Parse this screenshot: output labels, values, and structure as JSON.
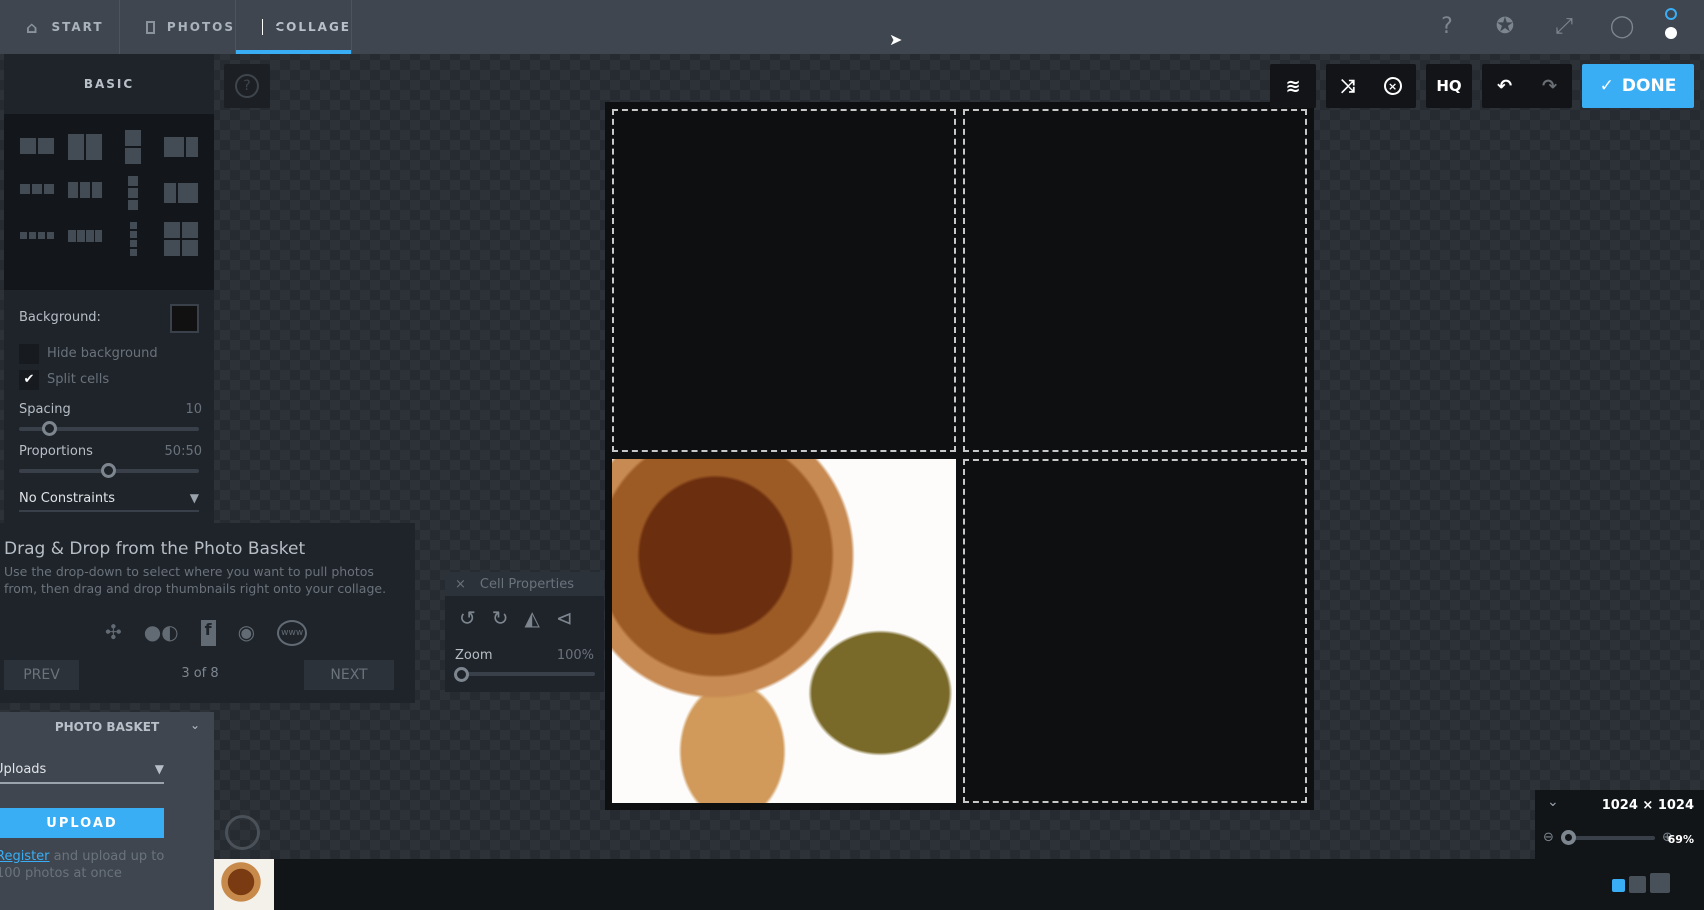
{
  "topbar": {
    "tabs": [
      {
        "label": "START",
        "icon": "home-icon"
      },
      {
        "label": "PHOTOS",
        "icon": "image-icon"
      },
      {
        "label": "COLLAGE",
        "icon": "collage-icon"
      }
    ],
    "active_tab": "COLLAGE",
    "right_icons": [
      "help-icon",
      "award-icon",
      "expand-icon",
      "user-icon",
      "dots-icon"
    ]
  },
  "sidebar": {
    "section": "BASIC",
    "background_label": "Background:",
    "background_color": "#111111",
    "hide_background": {
      "label": "Hide background",
      "checked": false
    },
    "split_cells": {
      "label": "Split cells",
      "checked": true
    },
    "spacing": {
      "label": "Spacing",
      "value": "10"
    },
    "proportions": {
      "label": "Proportions",
      "value": "50:50"
    },
    "constraints": "No Constraints"
  },
  "tooltip": {
    "title": "Drag & Drop from the Photo Basket",
    "text": "Use the drop-down to select where you want to pull photos from, then drag and drop thumbnails right onto your collage.",
    "sources": [
      "pinwheel-icon",
      "flickr-icon",
      "facebook-icon",
      "webcam-icon",
      "www-icon"
    ],
    "prev": "PREV",
    "next": "NEXT",
    "page": "3 of 8"
  },
  "cell_properties": {
    "title": "Cell Properties",
    "close": "×",
    "zoom_label": "Zoom",
    "zoom_value": "100%"
  },
  "basket": {
    "title": "PHOTO BASKET",
    "source": "Uploads",
    "upload": "UPLOAD",
    "register_link": "Register",
    "register_text": " and upload up to 100 photos at once"
  },
  "toolbar": {
    "hq": "HQ",
    "done": "DONE",
    "accent": "#3aaef5"
  },
  "zoom_panel": {
    "size": "1024 × 1024",
    "zoom": "69%"
  }
}
